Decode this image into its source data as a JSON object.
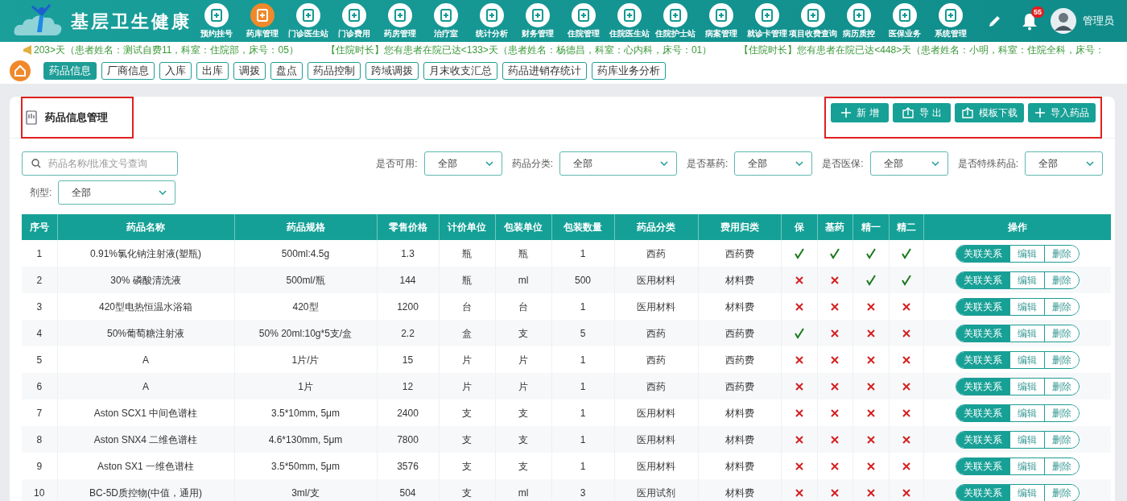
{
  "app": {
    "title": "基层卫生健康"
  },
  "nav": [
    {
      "label": "预约挂号",
      "selected": false
    },
    {
      "label": "药库管理",
      "selected": true
    },
    {
      "label": "门诊医生站",
      "selected": false
    },
    {
      "label": "门诊费用",
      "selected": false
    },
    {
      "label": "药房管理",
      "selected": false
    },
    {
      "label": "治疗室",
      "selected": false
    },
    {
      "label": "统计分析",
      "selected": false
    },
    {
      "label": "财务管理",
      "selected": false
    },
    {
      "label": "住院管理",
      "selected": false
    },
    {
      "label": "住院医生站",
      "selected": false
    },
    {
      "label": "住院护士站",
      "selected": false
    },
    {
      "label": "病案管理",
      "selected": false
    },
    {
      "label": "就诊卡管理",
      "selected": false
    },
    {
      "label": "项目收费查询",
      "selected": false
    },
    {
      "label": "病历质控",
      "selected": false
    },
    {
      "label": "医保业务",
      "selected": false
    },
    {
      "label": "系统管理",
      "selected": false
    }
  ],
  "notifications": {
    "count": "55"
  },
  "user": {
    "name": "管理员"
  },
  "ticker": [
    "203>天（患者姓名：测试自费11，科室：住院部，床号：05）",
    "【住院时长】您有患者在院已达<133>天（患者姓名：杨德昌，科室：心内科，床号：01）",
    "【住院时长】您有患者在院已达<448>天（患者姓名：小明，科室：住院全科，床号："
  ],
  "tabs": [
    {
      "label": "药品信息",
      "selected": true
    },
    {
      "label": "厂商信息",
      "selected": false
    },
    {
      "label": "入库",
      "selected": false
    },
    {
      "label": "出库",
      "selected": false
    },
    {
      "label": "调拨",
      "selected": false
    },
    {
      "label": "盘点",
      "selected": false
    },
    {
      "label": "药品控制",
      "selected": false
    },
    {
      "label": "跨域调拨",
      "selected": false
    },
    {
      "label": "月末收支汇总",
      "selected": false
    },
    {
      "label": "药品进销存统计",
      "selected": false
    },
    {
      "label": "药库业务分析",
      "selected": false
    }
  ],
  "panel": {
    "title": "药品信息管理",
    "highlighted": true
  },
  "toolbar": {
    "highlighted": true,
    "buttons": [
      {
        "label": "新 增",
        "kind": "plus"
      },
      {
        "label": "导 出",
        "kind": "upload"
      },
      {
        "label": "模板下载",
        "kind": "upload"
      },
      {
        "label": "导入药品",
        "kind": "plus"
      }
    ]
  },
  "search": {
    "placeholder": "药品名称/批准文号查询"
  },
  "filters": [
    {
      "label": "是否可用:",
      "value": "全部"
    },
    {
      "label": "药品分类:",
      "value": "全部"
    },
    {
      "label": "是否基药:",
      "value": "全部"
    },
    {
      "label": "是否医保:",
      "value": "全部"
    },
    {
      "label": "是否特殊药品:",
      "value": "全部"
    },
    {
      "label": "剂型:",
      "value": "全部"
    }
  ],
  "table": {
    "columns": [
      "序号",
      "药品名称",
      "药品规格",
      "零售价格",
      "计价单位",
      "包装单位",
      "包装数量",
      "药品分类",
      "费用归类",
      "保",
      "基药",
      "精一",
      "精二",
      "操作"
    ],
    "rows": [
      {
        "cells": [
          "1",
          "0.91%氯化钠注射液(塑瓶)",
          "500ml:4.5g",
          "1.3",
          "瓶",
          "瓶",
          "1",
          "西药",
          "西药费"
        ],
        "flags": [
          true,
          true,
          true,
          true
        ],
        "actions": [
          "关联关系",
          "编辑",
          "删除"
        ]
      },
      {
        "cells": [
          "2",
          "30% 磷酸清洗液",
          "500ml/瓶",
          "144",
          "瓶",
          "ml",
          "500",
          "医用材料",
          "材料费"
        ],
        "flags": [
          false,
          false,
          true,
          true
        ],
        "actions": [
          "关联关系",
          "编辑",
          "删除"
        ]
      },
      {
        "cells": [
          "3",
          "420型电热恒温水浴箱",
          "420型",
          "1200",
          "台",
          "台",
          "1",
          "医用材料",
          "材料费"
        ],
        "flags": [
          false,
          false,
          false,
          false
        ],
        "actions": [
          "关联关系",
          "编辑",
          "删除"
        ]
      },
      {
        "cells": [
          "4",
          "50%葡萄糖注射液",
          "50% 20ml:10g*5支/盒",
          "2.2",
          "盒",
          "支",
          "5",
          "西药",
          "西药费"
        ],
        "flags": [
          true,
          false,
          false,
          false
        ],
        "actions": [
          "关联关系",
          "编辑",
          "删除"
        ]
      },
      {
        "cells": [
          "5",
          "A",
          "1片/片",
          "15",
          "片",
          "片",
          "1",
          "西药",
          "西药费"
        ],
        "flags": [
          false,
          false,
          false,
          false
        ],
        "actions": [
          "关联关系",
          "编辑",
          "删除"
        ]
      },
      {
        "cells": [
          "6",
          "A",
          "1片",
          "12",
          "片",
          "片",
          "1",
          "西药",
          "西药费"
        ],
        "flags": [
          false,
          false,
          false,
          false
        ],
        "actions": [
          "关联关系",
          "编辑",
          "删除"
        ]
      },
      {
        "cells": [
          "7",
          "Aston SCX1 中间色谱柱",
          "3.5*10mm, 5μm",
          "2400",
          "支",
          "支",
          "1",
          "医用材料",
          "材料费"
        ],
        "flags": [
          false,
          false,
          false,
          false
        ],
        "actions": [
          "关联关系",
          "编辑",
          "删除"
        ]
      },
      {
        "cells": [
          "8",
          "Aston SNX4 二维色谱柱",
          "4.6*130mm, 5μm",
          "7800",
          "支",
          "支",
          "1",
          "医用材料",
          "材料费"
        ],
        "flags": [
          false,
          false,
          false,
          false
        ],
        "actions": [
          "关联关系",
          "编辑",
          "删除"
        ]
      },
      {
        "cells": [
          "9",
          "Aston SX1 一维色谱柱",
          "3.5*50mm, 5μm",
          "3576",
          "支",
          "支",
          "1",
          "医用材料",
          "材料费"
        ],
        "flags": [
          false,
          false,
          false,
          false
        ],
        "actions": [
          "关联关系",
          "编辑",
          "删除"
        ]
      },
      {
        "cells": [
          "10",
          "BC-5D质控物(中值，通用)",
          "3ml/支",
          "504",
          "支",
          "ml",
          "3",
          "医用试剂",
          "材料费"
        ],
        "flags": [
          false,
          false,
          false,
          false
        ],
        "actions": [
          "关联关系",
          "编辑",
          "删除"
        ]
      }
    ]
  }
}
